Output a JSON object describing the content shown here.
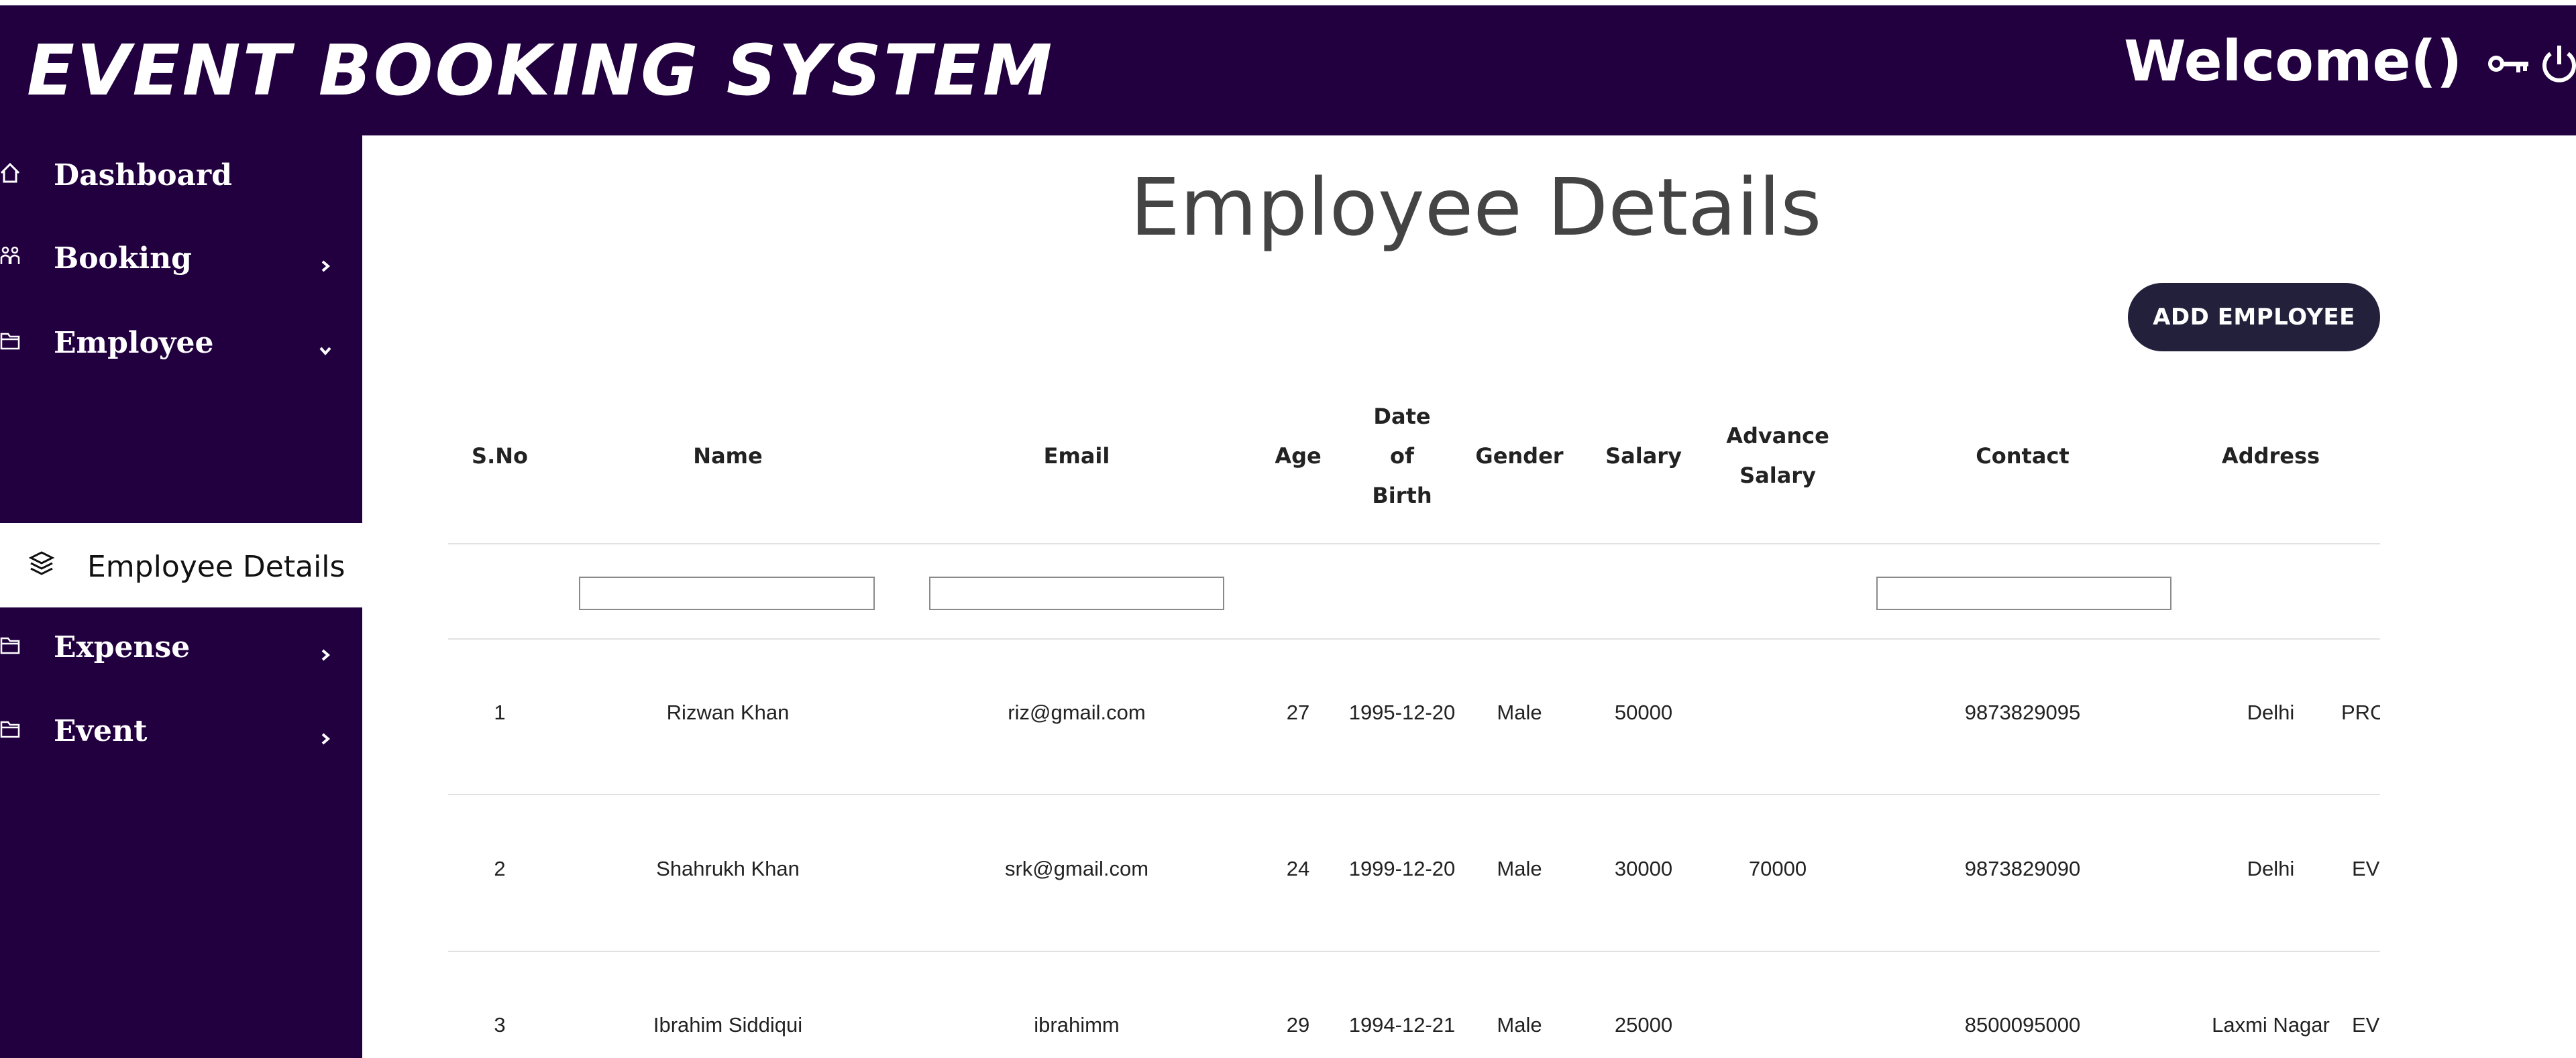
{
  "header": {
    "title": "EVENT BOOKING SYSTEM",
    "welcome": "Welcome()",
    "icons": [
      "key-icon",
      "power-icon"
    ],
    "background": "#22003f"
  },
  "sidebar": {
    "items": [
      {
        "label": "Dashboard",
        "icon": "home-icon"
      },
      {
        "label": "Booking",
        "icon": "users-icon",
        "chevron": "right"
      },
      {
        "label": "Employee",
        "icon": "folder-icon",
        "chevron": "down"
      },
      {
        "label": "Expense",
        "icon": "folder-icon",
        "chevron": "right"
      },
      {
        "label": "Event",
        "icon": "folder-icon",
        "chevron": "right"
      }
    ],
    "sub_item": {
      "label": "Employee Details",
      "icon": "layers-icon",
      "active": true
    }
  },
  "main": {
    "title": "Employee Details",
    "add_button": "ADD EMPLOYEE",
    "table": {
      "headers": {
        "sno": "S.No",
        "name": "Name",
        "email": "Email",
        "age": "Age",
        "dob_1": "Date",
        "dob_2": "of",
        "dob_3": "Birth",
        "gender": "Gender",
        "salary": "Salary",
        "adv_1": "Advance",
        "adv_2": "Salary",
        "contact": "Contact",
        "address": "Address"
      },
      "rows": [
        {
          "sno": "1",
          "name": "Rizwan Khan",
          "email": "riz@gmail.com",
          "age": "27",
          "dob": "1995-12-20",
          "gender": "Male",
          "salary": "50000",
          "advance": "",
          "contact": "9873829095",
          "address": "Delhi",
          "extra": "PRO"
        },
        {
          "sno": "2",
          "name": "Shahrukh Khan",
          "email": "srk@gmail.com",
          "age": "24",
          "dob": "1999-12-20",
          "gender": "Male",
          "salary": "30000",
          "advance": "70000",
          "contact": "9873829090",
          "address": "Delhi",
          "extra": "EV"
        },
        {
          "sno": "3",
          "name": "Ibrahim Siddiqui",
          "email": "ibrahimm",
          "age": "29",
          "dob": "1994-12-21",
          "gender": "Male",
          "salary": "25000",
          "advance": "",
          "contact": "8500095000",
          "address": "Laxmi Nagar",
          "extra": "EV"
        }
      ]
    }
  }
}
